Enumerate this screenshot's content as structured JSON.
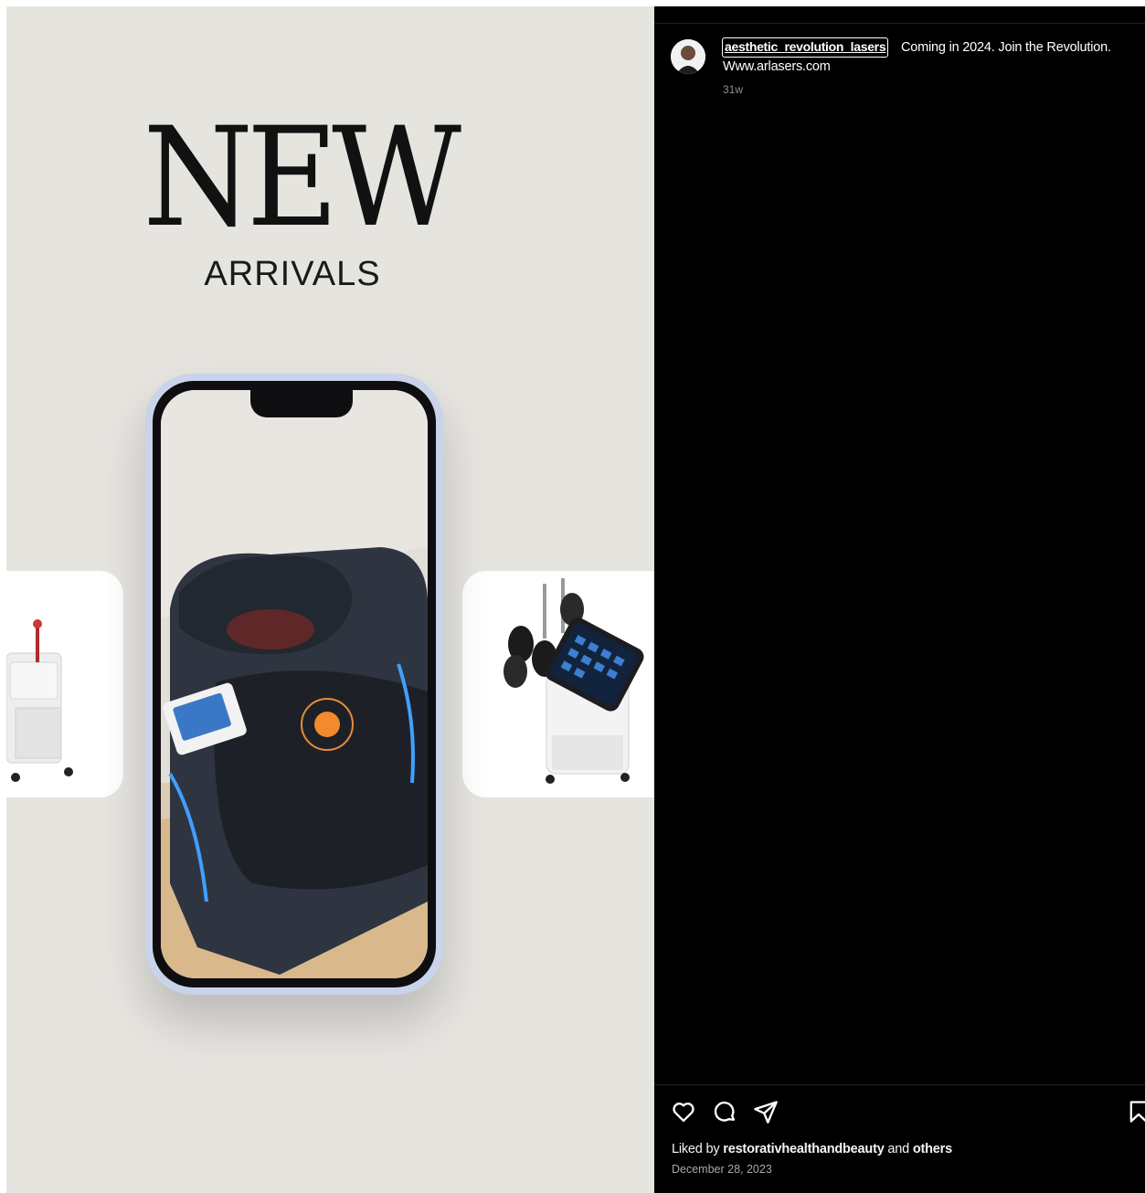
{
  "post_image": {
    "headline": "NEW",
    "subheadline": "ARRIVALS"
  },
  "post": {
    "username": "aesthetic_revolution_lasers",
    "caption": "Coming in 2024. Join the Revolution.",
    "link": "Www.arlasers.com",
    "time_ago": "31w"
  },
  "actions": {
    "icons": [
      "heart-icon",
      "comment-icon",
      "share-icon",
      "bookmark-icon"
    ]
  },
  "likes": {
    "prefix": "Liked by",
    "user": "restorativhealthandbeauty",
    "connector": "and",
    "others": "others"
  },
  "date": "December 28, 2023",
  "colors": {
    "panel_bg": "#000000",
    "media_bg": "#e6e4df",
    "muted_text": "#8e8e8e"
  }
}
